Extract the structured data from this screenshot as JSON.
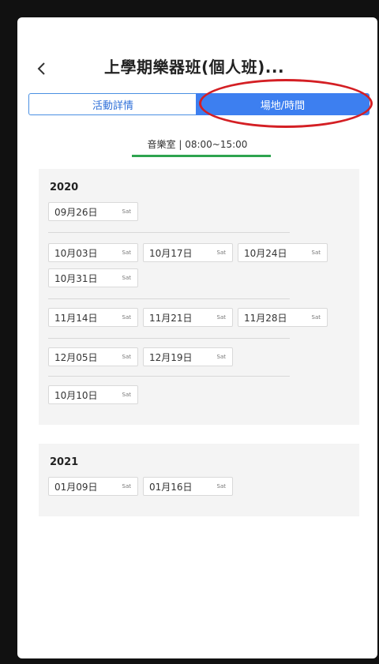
{
  "header": {
    "title": "上學期樂器班(個人班)..."
  },
  "tabs": [
    {
      "label": "活動詳情",
      "active": false
    },
    {
      "label": "場地/時間",
      "active": true
    }
  ],
  "location_time": "音樂室 | 08:00~15:00",
  "years": [
    {
      "year": "2020",
      "groups": [
        [
          {
            "date": "09月26日",
            "weekday": "Sat"
          }
        ],
        [
          {
            "date": "10月03日",
            "weekday": "Sat"
          },
          {
            "date": "10月17日",
            "weekday": "Sat"
          },
          {
            "date": "10月24日",
            "weekday": "Sat"
          },
          {
            "date": "10月31日",
            "weekday": "Sat"
          }
        ],
        [
          {
            "date": "11月14日",
            "weekday": "Sat"
          },
          {
            "date": "11月21日",
            "weekday": "Sat"
          },
          {
            "date": "11月28日",
            "weekday": "Sat"
          }
        ],
        [
          {
            "date": "12月05日",
            "weekday": "Sat"
          },
          {
            "date": "12月19日",
            "weekday": "Sat"
          }
        ],
        [
          {
            "date": "10月10日",
            "weekday": "Sat"
          }
        ]
      ]
    },
    {
      "year": "2021",
      "groups": [
        [
          {
            "date": "01月09日",
            "weekday": "Sat"
          },
          {
            "date": "01月16日",
            "weekday": "Sat"
          }
        ]
      ]
    }
  ],
  "colors": {
    "accent": "#3d7ff0",
    "annotation": "#d41f24",
    "underline": "#2ea44f"
  }
}
